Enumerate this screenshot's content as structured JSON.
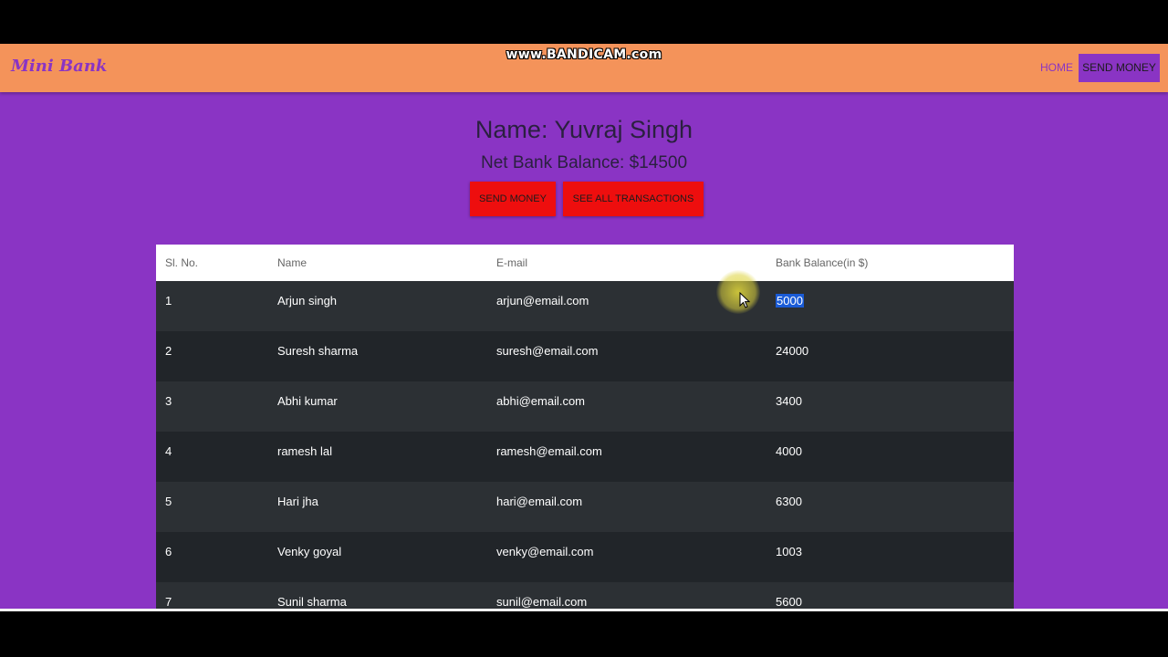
{
  "watermark": "www.BANDICAM.com",
  "navbar": {
    "brand": "Mini Bank",
    "links": [
      "HOME",
      "SEND MONEY"
    ]
  },
  "profile": {
    "name": "Name: Yuvraj Singh",
    "balance": "Net Bank Balance: $14500"
  },
  "actions": {
    "send_money": "SEND MONEY",
    "see_all": "SEE ALL TRANSACTIONS"
  },
  "table": {
    "headers": [
      "Sl. No.",
      "Name",
      "E-mail",
      "Bank Balance(in $)"
    ],
    "rows": [
      [
        "1",
        "Arjun singh",
        "arjun@email.com",
        "5000"
      ],
      [
        "2",
        "Suresh sharma",
        "suresh@email.com",
        "24000"
      ],
      [
        "3",
        "Abhi kumar",
        "abhi@email.com",
        "3400"
      ],
      [
        "4",
        "ramesh lal",
        "ramesh@email.com",
        "4000"
      ],
      [
        "5",
        "Hari jha",
        "hari@email.com",
        "6300"
      ],
      [
        "6",
        "Venky goyal",
        "venky@email.com",
        "1003"
      ],
      [
        "7",
        "Sunil sharma",
        "sunil@email.com",
        "5600"
      ]
    ]
  },
  "colors": {
    "page_bg": "#8a34c4",
    "navbar_bg": "#f4935a",
    "button_red": "#ee0e0e",
    "row_dark": "#212529",
    "row_light": "#2c3034",
    "selection": "#1a5bd6"
  }
}
